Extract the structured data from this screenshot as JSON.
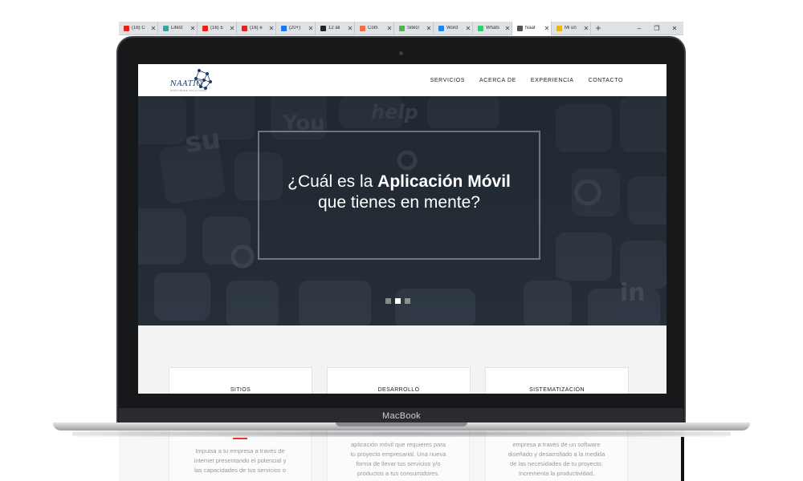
{
  "browser": {
    "tabs": [
      {
        "label": "(16) C",
        "icon": "youtube-icon",
        "color": "#e62117"
      },
      {
        "label": "Lifest",
        "icon": "lifestyle-site-icon",
        "color": "#2fa7a0"
      },
      {
        "label": "(16) E",
        "icon": "youtube-icon",
        "color": "#e62117"
      },
      {
        "label": "(16) e",
        "icon": "youtube-icon",
        "color": "#e62117"
      },
      {
        "label": "(20+)",
        "icon": "facebook-icon",
        "color": "#1877f2"
      },
      {
        "label": "12 ali",
        "icon": "v-site-icon",
        "color": "#222222"
      },
      {
        "label": "Cóm",
        "icon": "flower-site-icon",
        "color": "#e8734a"
      },
      {
        "label": "SiteG",
        "icon": "siteground-icon",
        "color": "#55b04e"
      },
      {
        "label": "Word",
        "icon": "wordpress-edit-icon",
        "color": "#1e88e5"
      },
      {
        "label": "Whats",
        "icon": "whatsapp-icon",
        "color": "#25d366"
      },
      {
        "label": "Naat",
        "icon": "naatio-site-icon",
        "color": "#555555",
        "active": true
      },
      {
        "label": "Mi un",
        "icon": "google-drive-icon",
        "color": "#f4b400"
      }
    ],
    "new_tab": "+",
    "close_glyph": "✕",
    "window_controls": {
      "minimize": "–",
      "maximize": "❐",
      "close": "✕"
    }
  },
  "laptop": {
    "brand": "MacBook"
  },
  "site": {
    "logo_text": "NAATIO",
    "logo_tagline": "SOFT-WARE SOLUTIONS",
    "nav": [
      "SERVICIOS",
      "ACERCA DE",
      "EXPERIENCIA",
      "CONTACTO"
    ],
    "hero": {
      "line1_prefix": "¿Cuál es la ",
      "line1_bold": "Aplicación Móvil",
      "line2": "que tienes en mente?",
      "active_slide": 2,
      "slides": 3
    },
    "services": [
      "SITIOS",
      "DESARROLLO",
      "SISTEMATIZACIÓN"
    ],
    "below": [
      [
        "Impulsa a tu empresa a través de",
        "internet presentando el potencial y",
        "las capacidades de tus servicios o"
      ],
      [
        "aplicación móvil que requieres para",
        "tu proyecto empresarial. Una nueva",
        "forma de llevar tus servicios y/o",
        "productos a tus consumidores."
      ],
      [
        "empresa a través de un software",
        "diseñado y desarrollado a la medida",
        "de las necesidades de tu proyecto.",
        "Incrementa la productividad,"
      ]
    ]
  }
}
